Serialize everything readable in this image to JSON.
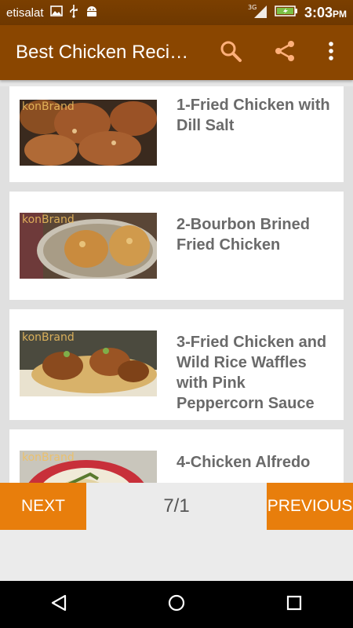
{
  "status_bar": {
    "carrier": "etisalat",
    "network": "3G",
    "time": "3:03",
    "ampm": "PM",
    "icons": [
      "image-icon",
      "usb-icon",
      "android-icon",
      "signal-icon",
      "battery-charging-icon"
    ]
  },
  "app_bar": {
    "title": "Best Chicken Reci…",
    "actions": [
      "search-icon",
      "share-icon",
      "overflow-menu-icon"
    ]
  },
  "recipes": [
    {
      "title": "1-Fried Chicken with Dill Salt",
      "watermark": "konBrand"
    },
    {
      "title": "2-Bourbon Brined Fried Chicken",
      "watermark": "konBrand"
    },
    {
      "title": "3-Fried Chicken and Wild Rice Waffles with Pink Peppercorn Sauce",
      "watermark": "konBrand"
    },
    {
      "title": "4-Chicken Alfredo",
      "watermark": "konBrand"
    }
  ],
  "pager": {
    "next_label": "NEXT",
    "previous_label": "PREVIOUS",
    "page_indicator": "7/1"
  },
  "colors": {
    "app_bar": "#8a4600",
    "button": "#e87e0c",
    "title_text": "#6a6a6a"
  }
}
